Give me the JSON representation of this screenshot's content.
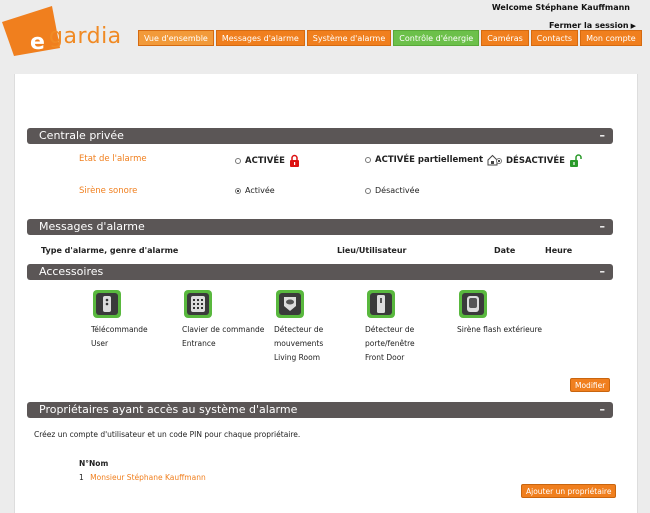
{
  "brand": {
    "logo_text": "gardia",
    "logo_letter": "e",
    "accent": "#f07f1e",
    "energy_color": "#6cc04a"
  },
  "header": {
    "welcome": "Welcome Stéphane Kauffmann",
    "logout": "Fermer la session",
    "logout_icon": "triangle-right-icon"
  },
  "nav": {
    "tabs": [
      {
        "label": "Vue d'ensemble",
        "active": true
      },
      {
        "label": "Messages d'alarme"
      },
      {
        "label": "Système d'alarme"
      },
      {
        "label": "Contrôle d'énergie"
      },
      {
        "label": "Caméras"
      },
      {
        "label": "Contacts"
      },
      {
        "label": "Mon compte"
      }
    ]
  },
  "centrale": {
    "title": "Centrale privée",
    "collapse": "–",
    "alarm_state_label": "Etat de l'alarme",
    "alarm_options": [
      {
        "label": "ACTIVÉE",
        "checked": false,
        "icon": "padlock-closed-red-icon"
      },
      {
        "label": "ACTIVÉE partiellement",
        "checked": false,
        "icon": "house-lock-icon"
      },
      {
        "label": "DÉSACTIVÉE",
        "checked": true,
        "icon": "padlock-open-green-icon"
      }
    ],
    "siren_label": "Sirène sonore",
    "siren_options": [
      {
        "label": "Activée",
        "checked": true
      },
      {
        "label": "Désactivée",
        "checked": false
      }
    ]
  },
  "messages": {
    "title": "Messages d'alarme",
    "collapse": "–",
    "columns": [
      "Type d'alarme, genre d'alarme",
      "Lieu/Utilisateur",
      "Date",
      "Heure"
    ]
  },
  "accessories": {
    "title": "Accessoires",
    "collapse": "–",
    "items": [
      {
        "line1": "Télécommande",
        "line2": "User",
        "line3": "",
        "line4": "",
        "icon": "remote-control-icon"
      },
      {
        "line1": "Clavier de commande",
        "line2": "Entrance",
        "line3": "",
        "line4": "",
        "icon": "keypad-icon"
      },
      {
        "line1": "Détecteur de",
        "line2": "mouvements",
        "line3": "Living Room",
        "line4": "",
        "icon": "motion-detector-icon"
      },
      {
        "line1": "Détecteur de",
        "line2": "porte/fenêtre",
        "line3": "Front Door",
        "line4": "",
        "icon": "door-sensor-icon"
      },
      {
        "line1": "Sirène flash extérieure",
        "line2": "",
        "line3": "",
        "line4": "",
        "icon": "siren-icon"
      }
    ],
    "modify_button": "Modifier"
  },
  "owners": {
    "title": "Propriétaires ayant accès au système d'alarme",
    "collapse": "–",
    "description": "Créez un compte d'utilisateur et un code PIN pour chaque propriétaire.",
    "col_no": "N°",
    "col_name": "Nom",
    "rows": [
      {
        "no": "1",
        "name": "Monsieur Stéphane Kauffmann"
      }
    ],
    "add_button": "Ajouter un propriétaire"
  }
}
